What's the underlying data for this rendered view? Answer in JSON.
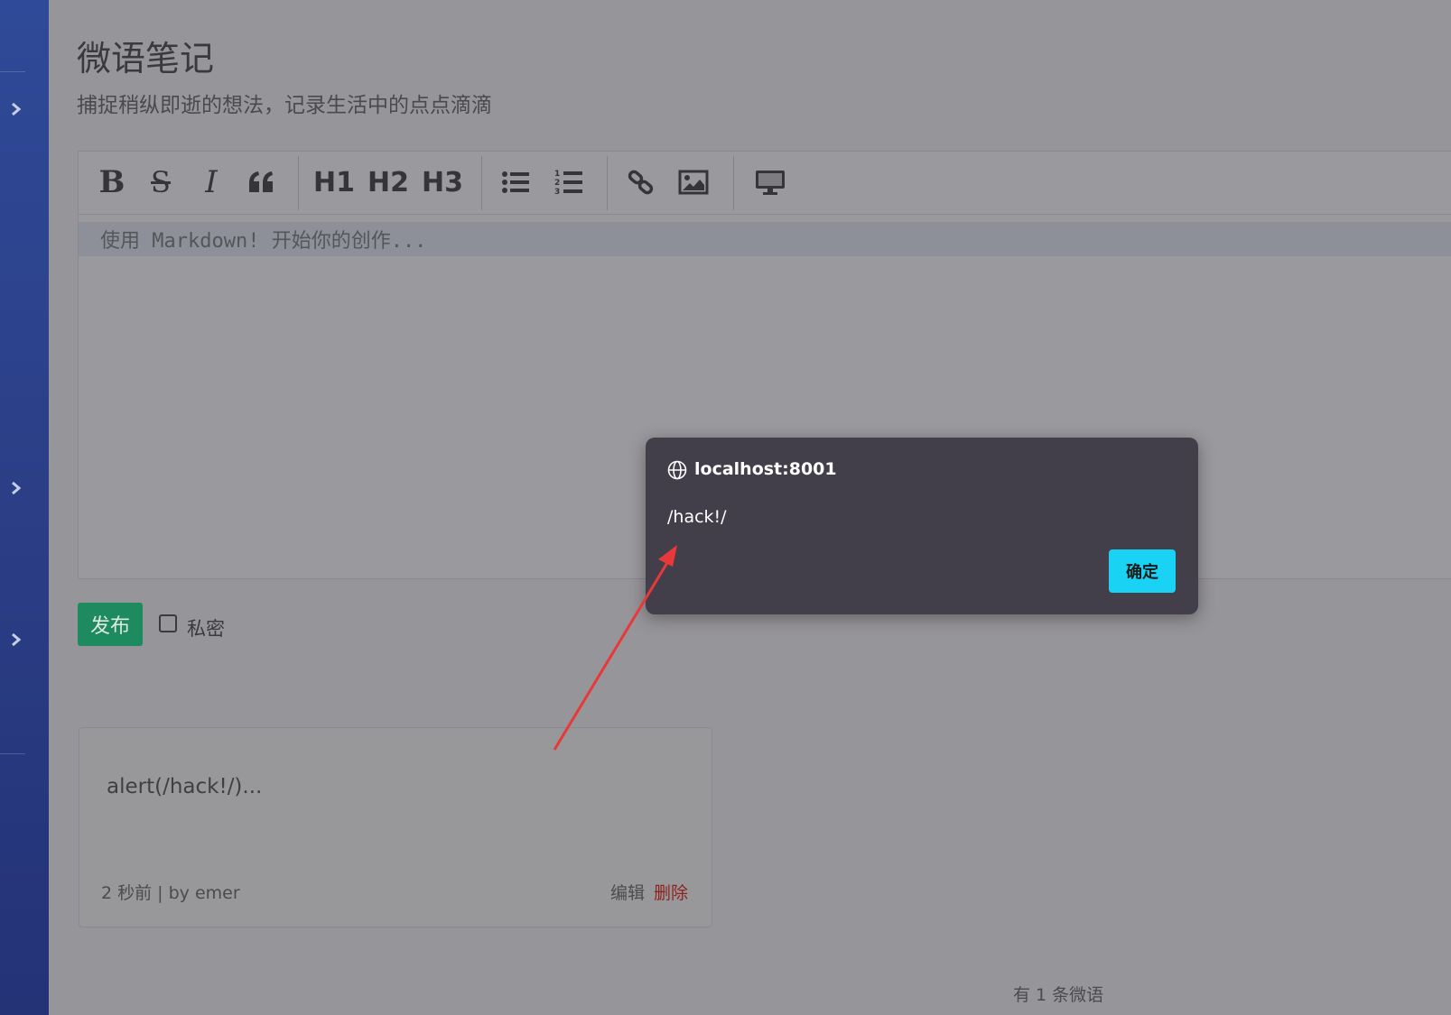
{
  "page": {
    "title": "微语笔记",
    "subtitle": "捕捉稍纵即逝的想法，记录生活中的点点滴滴"
  },
  "sidebar": {
    "icons": [
      "chevron-right-icon",
      "chevron-right-icon",
      "chevron-right-icon"
    ],
    "color": "#2b3e86"
  },
  "toolbar": {
    "buttons": {
      "bold": "B",
      "strike": "S",
      "italic": "I",
      "quote": "quote-icon",
      "h1": "H1",
      "h2": "H2",
      "h3": "H3",
      "ul": "unordered-list-icon",
      "ol": "ordered-list-icon",
      "link": "link-icon",
      "image": "image-icon",
      "preview": "preview-monitor-icon"
    }
  },
  "editor": {
    "placeholder": "使用 Markdown! 开始你的创作..."
  },
  "form": {
    "publish_label": "发布",
    "private_label": "私密",
    "private_checked": false,
    "publish_color": "#1e8a5f"
  },
  "notes": [
    {
      "content": "alert(/hack!/)...",
      "meta": "2 秒前 | by emer",
      "edit_label": "编辑",
      "delete_label": "删除"
    }
  ],
  "footer": {
    "count_text": "有 1 条微语"
  },
  "dialog": {
    "host": "localhost:8001",
    "message": "/hack!/",
    "ok_label": "确定",
    "icon": "globe-icon",
    "ok_color": "#1ad3f4",
    "background": "#423f4b"
  },
  "annotation": {
    "color": "#e8383a",
    "icon": "red-arrow-annotation"
  }
}
